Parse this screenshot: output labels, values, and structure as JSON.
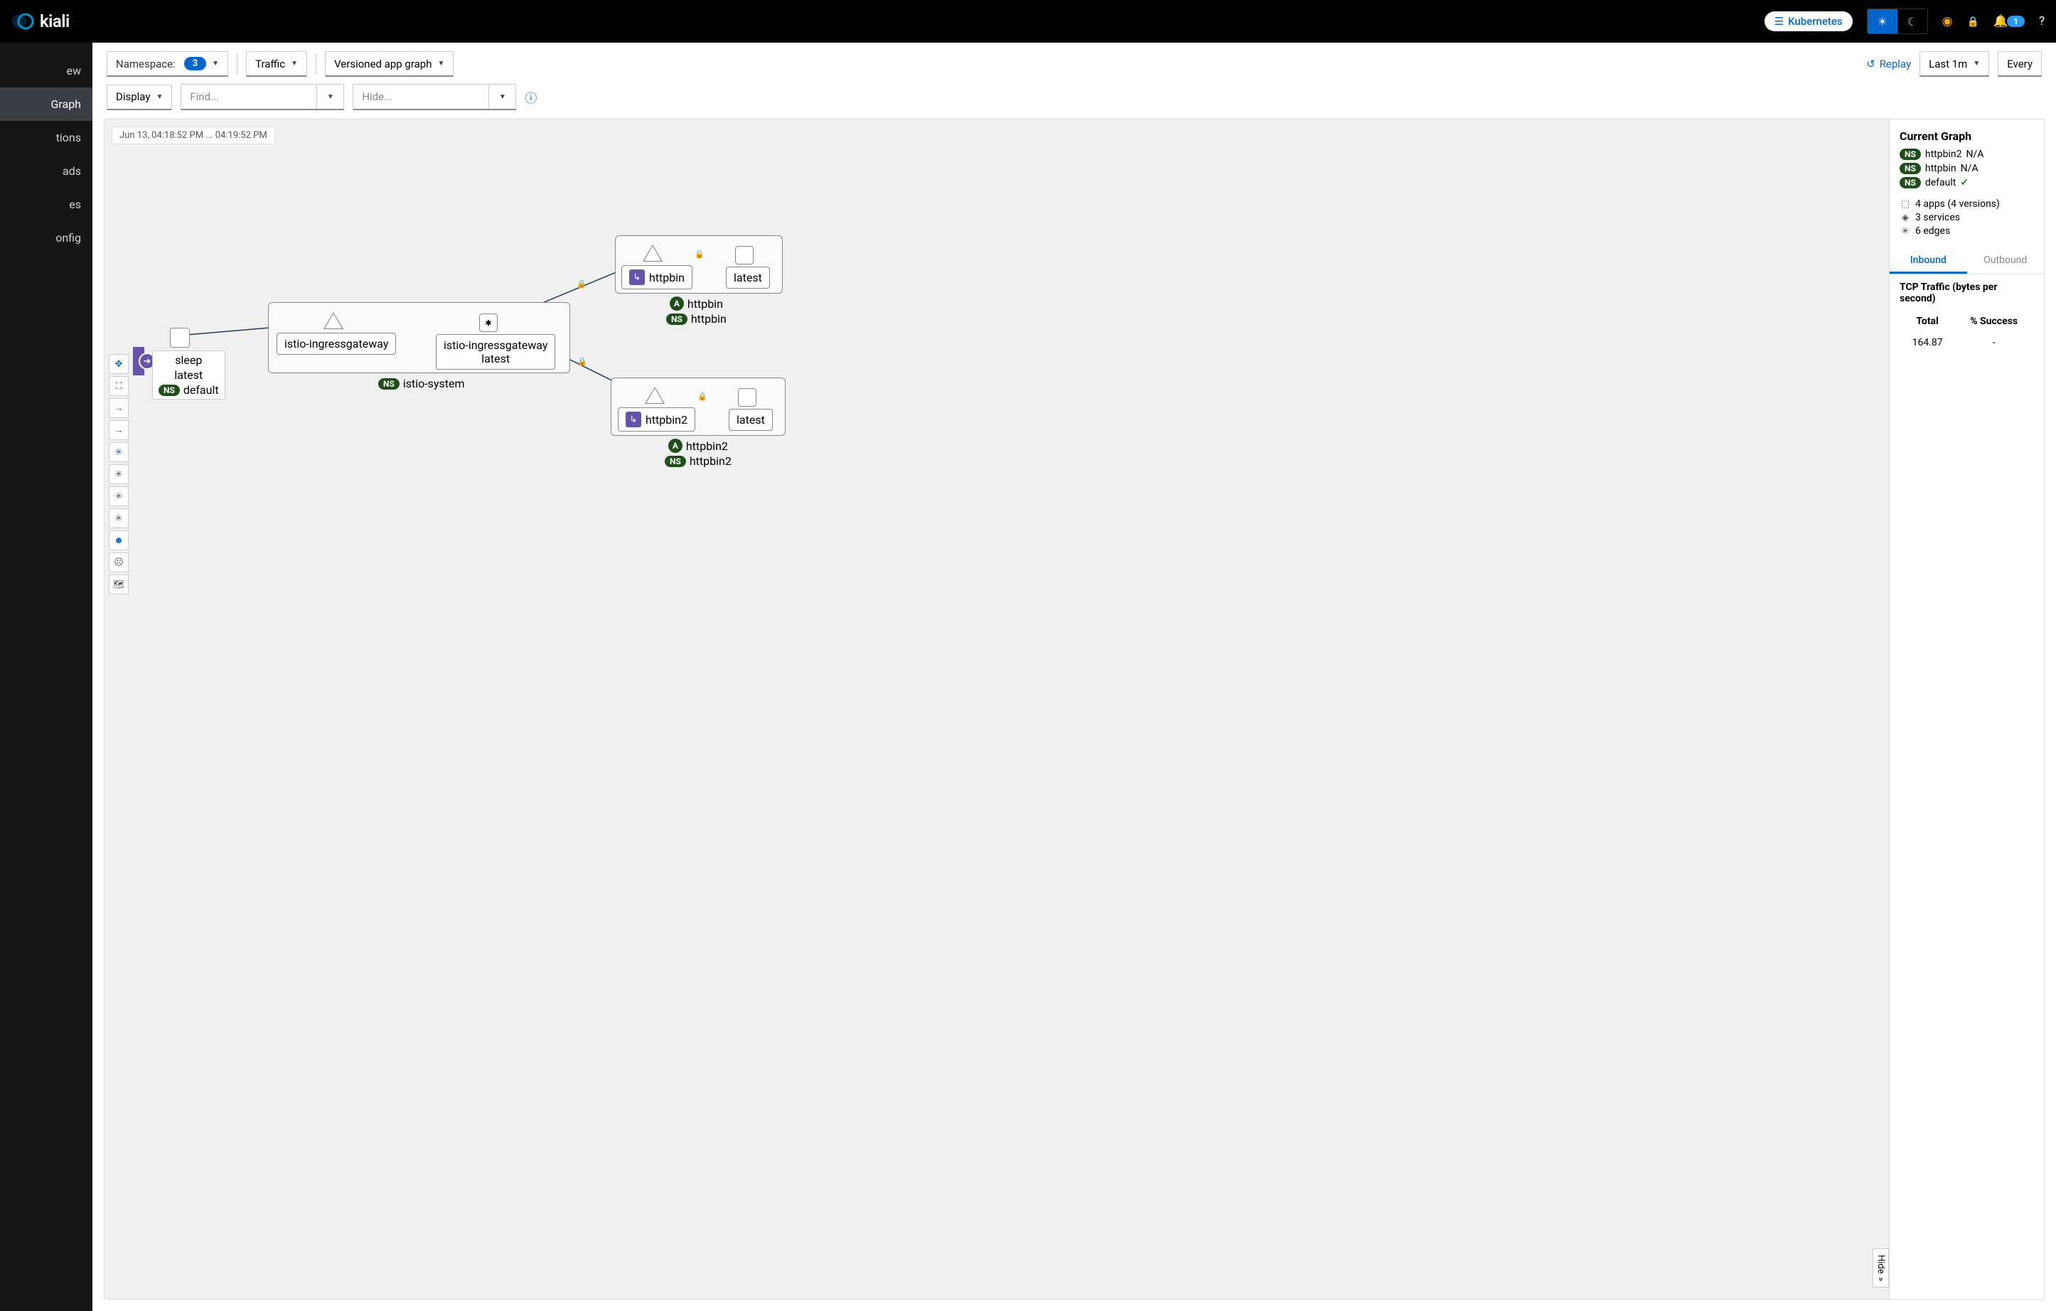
{
  "header": {
    "brand": "kiali",
    "cluster_label": "Kubernetes",
    "notification_count": "1"
  },
  "sidebar": {
    "items": [
      {
        "label": "ew"
      },
      {
        "label": "Graph"
      },
      {
        "label": "tions"
      },
      {
        "label": "ads"
      },
      {
        "label": "es"
      },
      {
        "label": "onfig"
      }
    ],
    "active_index": 1
  },
  "toolbar": {
    "namespace_label": "Namespace:",
    "namespace_count": "3",
    "traffic_label": "Traffic",
    "graph_type_label": "Versioned app graph",
    "replay_label": "Replay",
    "time_range_label": "Last 1m",
    "refresh_label": "Every",
    "display_label": "Display",
    "find_placeholder": "Find...",
    "hide_placeholder": "Hide..."
  },
  "canvas": {
    "time_label": "Jun 13, 04:18:52 PM ... 04:19:52 PM",
    "sleep_app": "sleep",
    "sleep_version": "latest",
    "sleep_ns": "default",
    "istio_system": "istio-system",
    "igw_svc": "istio-ingressgateway",
    "igw_wl": "istio-ingressgateway",
    "igw_wl_ver": "latest",
    "httpbin": "httpbin",
    "httpbin_latest": "latest",
    "httpbin_app": "httpbin",
    "httpbin_ns": "httpbin",
    "httpbin2": "httpbin2",
    "httpbin2_latest": "latest",
    "httpbin2_app": "httpbin2",
    "httpbin2_ns": "httpbin2",
    "hide_label": "Hide"
  },
  "panel": {
    "title": "Current Graph",
    "ns_rows": [
      {
        "name": "httpbin2",
        "status": "N/A"
      },
      {
        "name": "httpbin",
        "status": "N/A"
      },
      {
        "name": "default",
        "status": "ok"
      }
    ],
    "summary": {
      "apps": "4 apps (4 versions)",
      "services": "3 services",
      "edges": "6 edges"
    },
    "tabs": {
      "inbound": "Inbound",
      "outbound": "Outbound"
    },
    "traffic_title": "TCP Traffic (bytes per second)",
    "table": {
      "col_total": "Total",
      "col_success": "% Success",
      "val_total": "164.87",
      "val_success": "-"
    }
  }
}
